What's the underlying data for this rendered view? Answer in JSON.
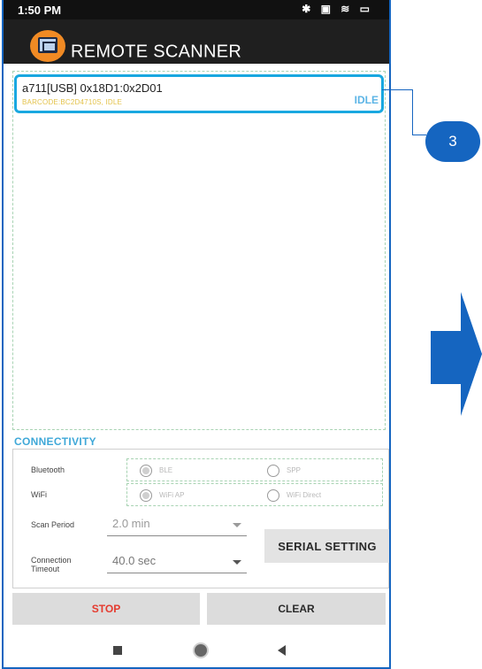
{
  "status_bar": {
    "time": "1:50 PM",
    "icons": "✱ ▣ ≋ ▭"
  },
  "app": {
    "title": "REMOTE SCANNER",
    "icon": "scanner-app-icon"
  },
  "device_list": {
    "items": [
      {
        "name": "a711[USB] 0x18D1:0x2D01",
        "detail": "BARCODE:BC2D4710S, IDLE",
        "status": "IDLE",
        "selected": true
      }
    ]
  },
  "callout": {
    "number": "3"
  },
  "connectivity": {
    "title": "CONNECTIVITY",
    "bluetooth": {
      "label": "Bluetooth",
      "options": [
        "BLE",
        "SPP"
      ],
      "selected": "BLE"
    },
    "wifi": {
      "label": "WiFi",
      "options": [
        "WiFi AP",
        "WiFi Direct"
      ],
      "selected": "WiFi AP"
    },
    "scan_period": {
      "label": "Scan Period",
      "value": "2.0 min"
    },
    "connection_timeout": {
      "label_line1": "Connection",
      "label_line2": "Timeout",
      "value": "40.0 sec"
    },
    "serial_setting_label": "SERIAL SETTING"
  },
  "actions": {
    "stop_label": "STOP",
    "clear_label": "CLEAR"
  },
  "colors": {
    "accent": "#19a8e0",
    "callout_blue": "#1565c0",
    "stop_red": "#e53a2e",
    "app_bar": "#1f1f1f",
    "status_idle": "#5bb4e6"
  }
}
